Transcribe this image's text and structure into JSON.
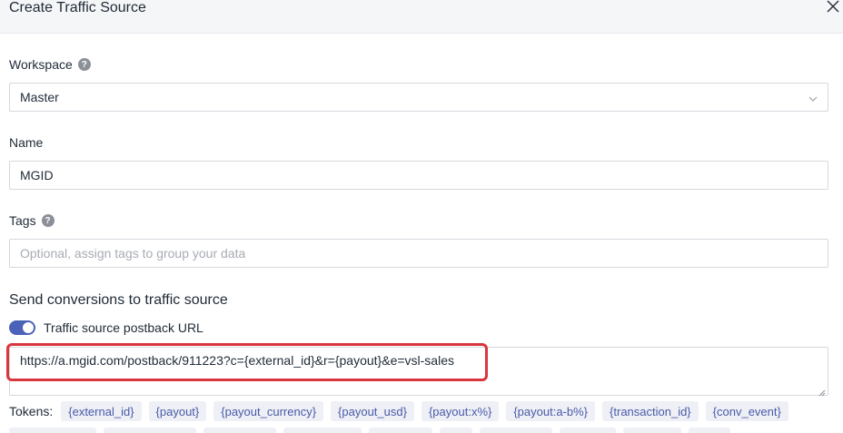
{
  "dialog": {
    "title": "Create Traffic Source",
    "close_icon": "close-icon"
  },
  "workspace": {
    "label": "Workspace",
    "help_icon": "?",
    "value": "Master"
  },
  "name": {
    "label": "Name",
    "value": "MGID"
  },
  "tags": {
    "label": "Tags",
    "help_icon": "?",
    "placeholder": "Optional, assign tags to group your data"
  },
  "conversions": {
    "section_title": "Send conversions to traffic source",
    "toggle_label": "Traffic source postback URL",
    "toggle_on": true,
    "postback_url": "https://a.mgid.com/postback/911223?c={external_id}&r={payout}&e=vsl-sales"
  },
  "tokens": {
    "label": "Tokens:",
    "items": [
      "{external_id}",
      "{payout}",
      "{payout_currency}",
      "{payout_usd}",
      "{payout:x%}",
      "{payout:a-b%}",
      "{transaction_id}",
      "{conv_event}"
    ]
  },
  "colors": {
    "accent": "#4a62b8",
    "highlight": "#d9363e",
    "chip_bg": "#eef0f6",
    "chip_text": "#4a5aa8"
  }
}
